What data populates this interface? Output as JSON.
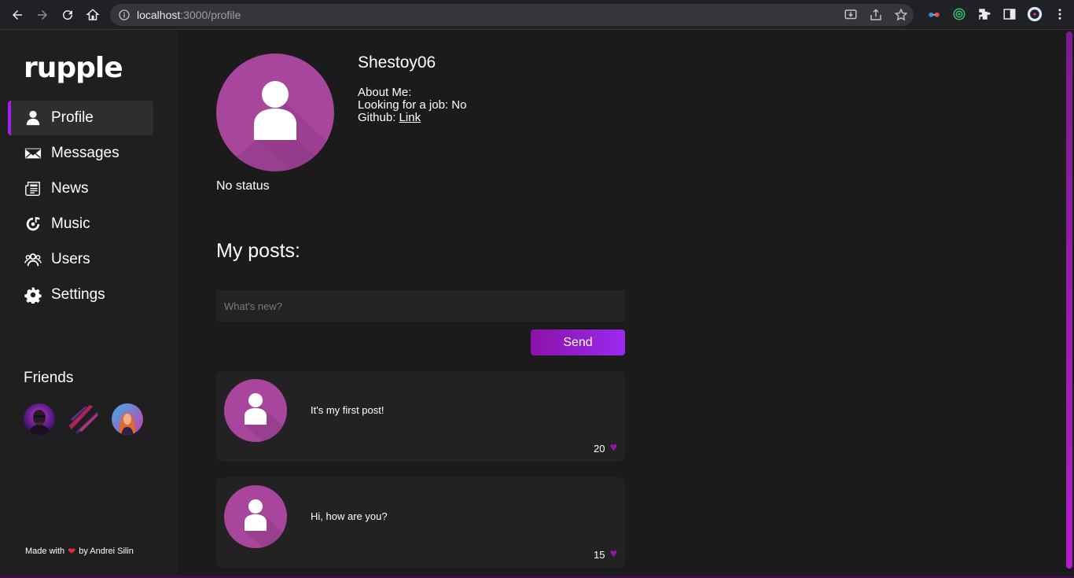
{
  "browser": {
    "url_host": "localhost",
    "url_path": ":3000/profile"
  },
  "sidebar": {
    "logo": "rupple",
    "items": [
      {
        "label": "Profile",
        "icon": "user-icon"
      },
      {
        "label": "Messages",
        "icon": "envelope-icon"
      },
      {
        "label": "News",
        "icon": "newspaper-icon"
      },
      {
        "label": "Music",
        "icon": "music-disc-icon"
      },
      {
        "label": "Users",
        "icon": "users-icon"
      },
      {
        "label": "Settings",
        "icon": "gear-icon"
      }
    ],
    "friends_title": "Friends",
    "footer_prefix": "Made with",
    "footer_suffix": "by Andrei Silin"
  },
  "profile": {
    "username": "Shestoy06",
    "about_label": "About Me:",
    "job_label": "Looking for a job: No",
    "github_label": "Github:",
    "github_link": "Link",
    "status": "No status"
  },
  "posts": {
    "title": "My posts:",
    "input_placeholder": "What's new?",
    "send_label": "Send",
    "items": [
      {
        "text": "It's my first post!",
        "likes": "20"
      },
      {
        "text": "Hi, how are you?",
        "likes": "15"
      }
    ]
  },
  "colors": {
    "accent": "#9b2af0",
    "avatar_bg": "#a8469d",
    "like_heart": "#9b10b0"
  }
}
